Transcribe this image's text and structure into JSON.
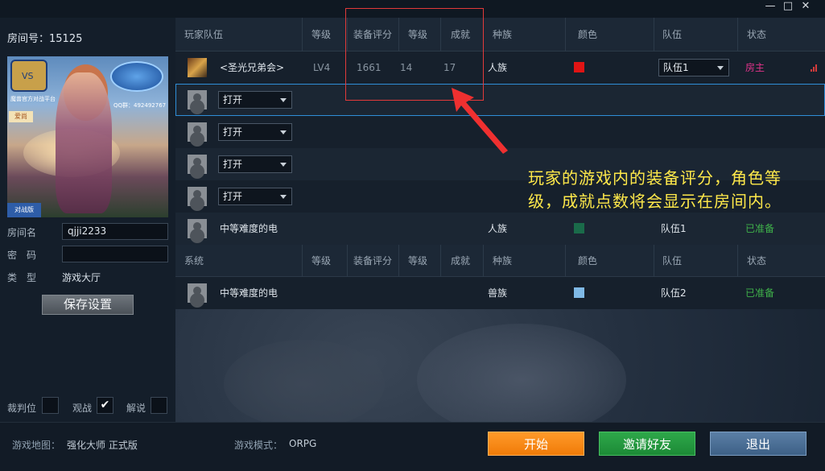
{
  "window": {
    "minimize_glyph": "—",
    "maximize_glyph": "□",
    "close_glyph": "✕"
  },
  "room": {
    "number_label": "房间号：15125",
    "map_image": {
      "logo_left": "VS",
      "brand_text": "魔兽官方对战平台",
      "contact": "QQ群：492492767",
      "badge": "爱尚",
      "corner": "对战版"
    },
    "fields": [
      {
        "label": "房间名",
        "value": "qjji2233"
      },
      {
        "label": "密　码",
        "value": ""
      },
      {
        "label": "类　型",
        "value": "游戏大厅"
      }
    ],
    "save_button": "保存设置",
    "checks": [
      {
        "label": "裁判位",
        "checked": false
      },
      {
        "label": "观战",
        "checked": true
      },
      {
        "label": "解说",
        "checked": false
      }
    ]
  },
  "players_header": {
    "columns": [
      "玩家队伍",
      "等级",
      "装备评分",
      "等级",
      "成就",
      "种族",
      "颜色",
      "队伍",
      "状态"
    ]
  },
  "players": [
    {
      "type": "player",
      "name": "<圣光兄弟会>",
      "level": "LV4",
      "gear_score": "1661",
      "char_level": "14",
      "achievements": "17",
      "race": "人族",
      "color": "#e01414",
      "team": "队伍1",
      "status": "房主",
      "status_kind": "host"
    },
    {
      "type": "open",
      "slot_value": "打开"
    },
    {
      "type": "open",
      "slot_value": "打开"
    },
    {
      "type": "open",
      "slot_value": "打开"
    },
    {
      "type": "open",
      "slot_value": "打开"
    },
    {
      "type": "ai",
      "name": "中等难度的电",
      "race": "人族",
      "color": "#1a6b4a",
      "team": "队伍1",
      "status": "已准备",
      "status_kind": "ready"
    }
  ],
  "system_header": {
    "columns": [
      "系统",
      "等级",
      "装备评分",
      "等级",
      "成就",
      "种族",
      "颜色",
      "队伍",
      "状态"
    ]
  },
  "system": [
    {
      "type": "ai",
      "name": "中等难度的电",
      "race": "兽族",
      "color": "#7fb9e6",
      "team": "队伍2",
      "status": "已准备",
      "status_kind": "ready"
    }
  ],
  "annotation": {
    "line1": "玩家的游戏内的装备评分，角色等",
    "line2": "级，成就点数将会显示在房间内。"
  },
  "footer": {
    "map_label": "游戏地图：",
    "map_value": "强化大师 正式版",
    "mode_label": "游戏模式：",
    "mode_value": "ORPG",
    "start_button": "开始",
    "invite_button": "邀请好友",
    "exit_button": "退出"
  }
}
